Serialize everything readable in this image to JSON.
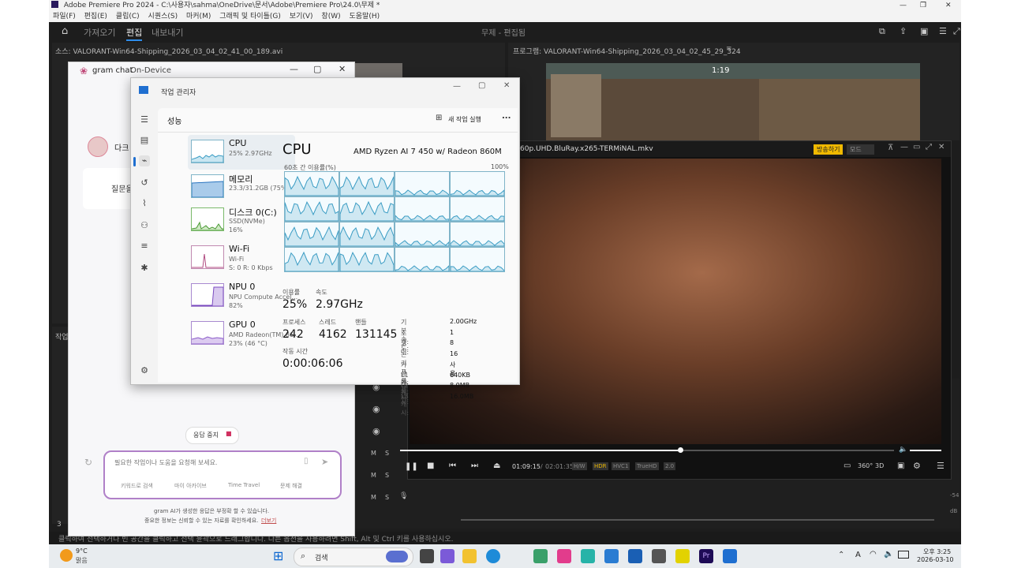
{
  "premiere": {
    "title": "Adobe Premiere Pro 2024 - C:\\사용자\\sahma\\OneDrive\\문서\\Adobe\\Premiere Pro\\24.0\\무제 *",
    "menu": [
      "파일(F)",
      "편집(E)",
      "클립(C)",
      "시퀀스(S)",
      "마커(M)",
      "그래픽 및 타이틀(G)",
      "보기(V)",
      "창(W)",
      "도움말(H)"
    ],
    "tabs": [
      "가져오기",
      "편집",
      "내보내기"
    ],
    "project_name": "무제 - 편집됨",
    "source_panel": "소스: VALORANT-Win64-Shipping_2026_03_04_02_41_00_189.avi",
    "program_panel": "프로그램: VALORANT-Win64-Shipping_2026_03_04_02_45_29_324",
    "game_timer": "1:19",
    "left_panel_label": "작업",
    "track_letters": [
      "M",
      "S"
    ],
    "meter_labels": [
      "-54",
      "dB"
    ],
    "status_hint": "클릭하여 선택하거나 빈 공간을 클릭하고 선택 윤곽으로 드래그합니다. 다른 옵션을 사용하려면 Shift, Alt 및 Ctrl 키를 사용하십시오.",
    "bottom_left_number": "3"
  },
  "gram_chat": {
    "title": "gram chat",
    "mode": "On-Device",
    "profile_name": "다크",
    "card_text": "질문을",
    "stop_button": "응답 중지",
    "input_placeholder": "필요한 작업이나 도움을 요청해 보세요.",
    "chips": [
      "키워드로 검색",
      "마이 아카이브",
      "Time Travel",
      "문제 해결"
    ],
    "disclaimer_1": "gram AI가 생성한 응답은 부정확 할 수 있습니다.",
    "disclaimer_2": "중요한 정보는 신뢰할 수 있는 자료를 확인하세요.",
    "disclaimer_link": "더보기"
  },
  "task_manager": {
    "title": "작업 관리자",
    "section": "성능",
    "new_task": "새 작업 실행",
    "more": "...",
    "processes": [
      {
        "name": "CPU",
        "sub1": "25% 2.97GHz",
        "sub2": ""
      },
      {
        "name": "메모리",
        "sub1": "23.3/31.2GB (75%)",
        "sub2": ""
      },
      {
        "name": "디스크 0(C:)",
        "sub1": "SSD(NVMe)",
        "sub2": "16%"
      },
      {
        "name": "Wi-Fi",
        "sub1": "Wi-Fi",
        "sub2": "S: 0 R: 0 Kbps"
      },
      {
        "name": "NPU 0",
        "sub1": "NPU Compute Accel...",
        "sub2": "82%"
      },
      {
        "name": "GPU 0",
        "sub1": "AMD Radeon(TM) 86...",
        "sub2": "23% (46 °C)"
      }
    ],
    "detail_title": "CPU",
    "cpu_model": "AMD Ryzen AI 7 450 w/ Radeon 860M",
    "graph_caption": "60초 간 이용률(%)",
    "graph_max": "100%",
    "stats": {
      "usage_label": "이용률",
      "usage": "25%",
      "speed_label": "속도",
      "speed": "2.97GHz",
      "process_label": "프로세스",
      "process": "242",
      "thread_label": "스레드",
      "thread": "4162",
      "handle_label": "핸들",
      "handle": "131145",
      "uptime_label": "작동 시간",
      "uptime": "0:00:06:06"
    },
    "specs": [
      {
        "k": "기본 속도:",
        "v": "2.00GHz"
      },
      {
        "k": "소켓:",
        "v": "1"
      },
      {
        "k": "코어:",
        "v": "8"
      },
      {
        "k": "논리 프로세서:",
        "v": "16"
      },
      {
        "k": "가상화:",
        "v": "사용"
      },
      {
        "k": "L1 캐시:",
        "v": "640KB"
      },
      {
        "k": "L2 캐시:",
        "v": "8.0MB"
      },
      {
        "k": "L3 캐시:",
        "v": "16.0MB"
      }
    ]
  },
  "video_player": {
    "filename": "60p.UHD.BluRay.x265-TERMiNAL.mkv",
    "badge": "방송하기",
    "mode": "모드",
    "time_current": "01:09:15",
    "time_total": "02:01:35",
    "tags": [
      "H/W",
      "HDR",
      "HVC1",
      "TrueHD",
      "2.0"
    ],
    "extra_tags": [
      "360°",
      "3D"
    ]
  },
  "taskbar": {
    "weather_temp": "9°C",
    "weather_desc": "맑음",
    "search": "검색",
    "time": "오후 3:25",
    "date": "2026-03-10",
    "ime": "A"
  }
}
